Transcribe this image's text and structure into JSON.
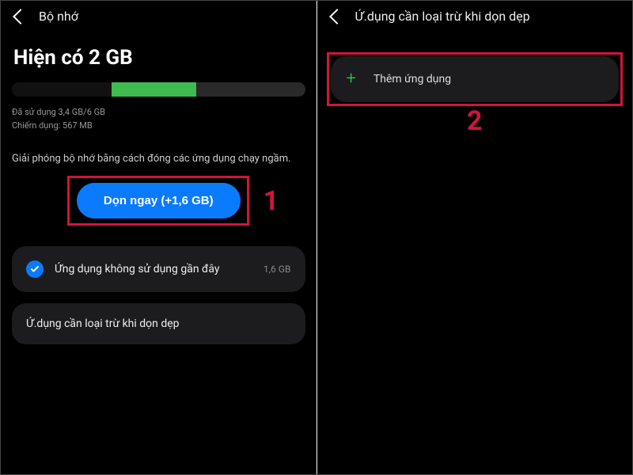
{
  "left": {
    "header_title": "Bộ nhớ",
    "main_title": "Hiện có 2 GB",
    "usage_line": "Đã sử dụng 3,4 GB/6 GB",
    "occupied_line": "Chiếm dụng: 567 MB",
    "hint": "Giải phóng bộ nhớ bằng cách đóng các ứng dụng chạy ngầm.",
    "clean_button": "Dọn ngay (+1,6 GB)",
    "card1_label": "Ứng dụng không sử dụng gần đây",
    "card1_value": "1,6 GB",
    "card2_label": "Ứ.dụng cần loại trừ khi dọn dẹp",
    "annotation": "1",
    "bar": {
      "dark_pct": 34,
      "green_pct": 29
    }
  },
  "right": {
    "header_title": "Ứ.dụng cần loại trừ khi dọn dẹp",
    "add_label": "Thêm ứng dụng",
    "annotation": "2"
  },
  "colors": {
    "accent_blue": "#0a7aff",
    "accent_green": "#3fbb4f",
    "annotation_red": "#d1143a"
  }
}
